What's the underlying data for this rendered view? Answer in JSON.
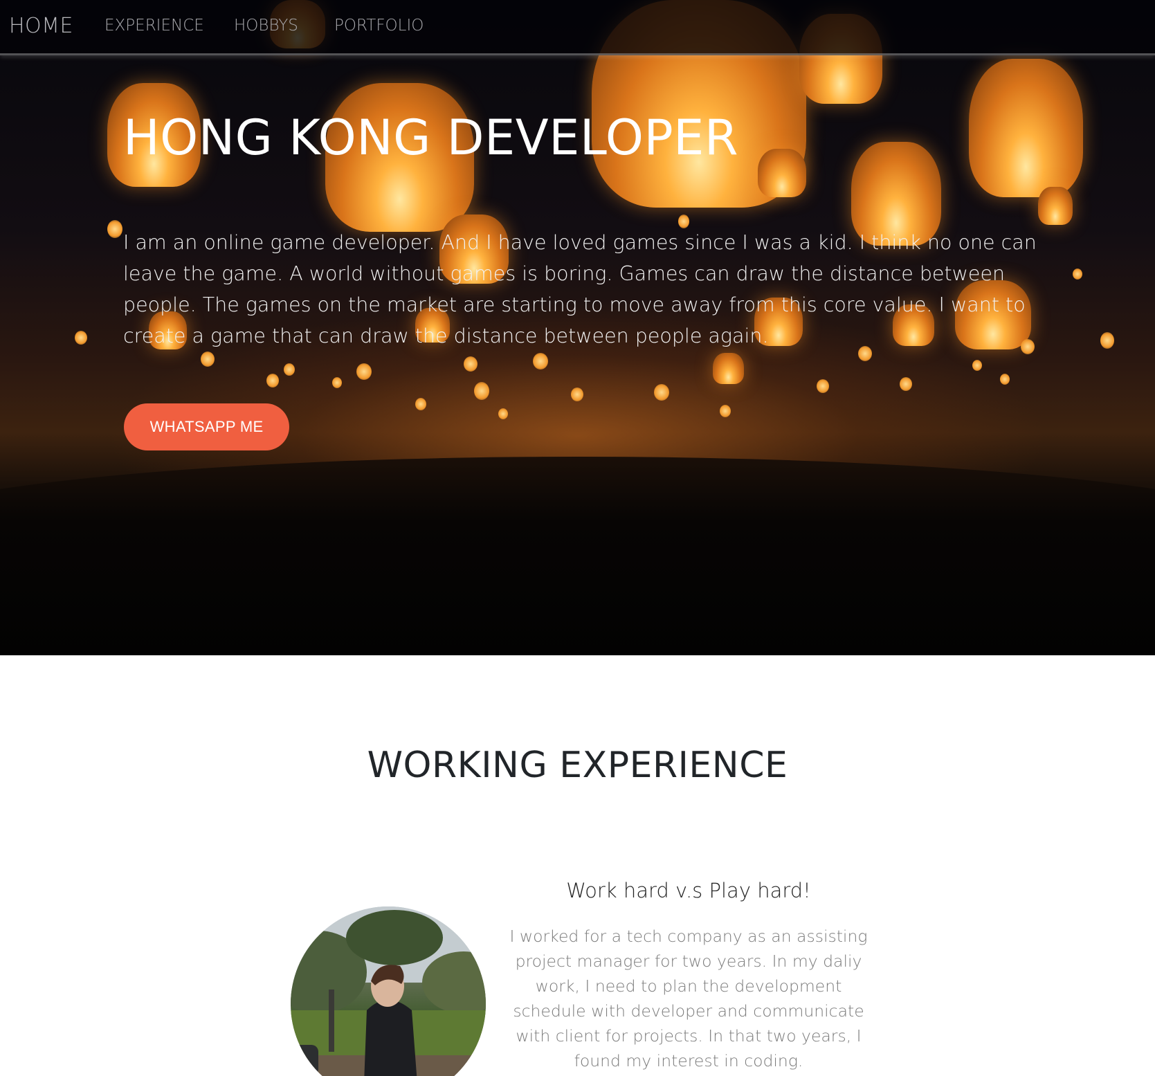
{
  "nav": {
    "brand": "HOME",
    "links": [
      "EXPERIENCE",
      "HOBBYS",
      "PORTFOLIO"
    ]
  },
  "hero": {
    "title": "HONG KONG DEVELOPER",
    "text": "I am an online game developer. And I have loved games since I was a kid. I think no one can leave the game. A world without games is boring. Games can draw the distance between people. The games on the market are starting to move away from this core value. I want to create a game that can draw the distance between people again.",
    "button_label": "WHATSAPP ME"
  },
  "experience": {
    "title": "WORKING EXPERIENCE",
    "subtitle": "Work hard v.s Play hard!",
    "text": "I worked for a tech company as an assisting project manager for two years. In my daliy work, I need to plan the development schedule with developer and communicate with client for projects. In that two years, I found my interest in coding."
  },
  "colors": {
    "accent": "#f05f40",
    "nav_background": "#030308",
    "heading_text": "#212529",
    "muted_text": "#7b7b7b"
  }
}
